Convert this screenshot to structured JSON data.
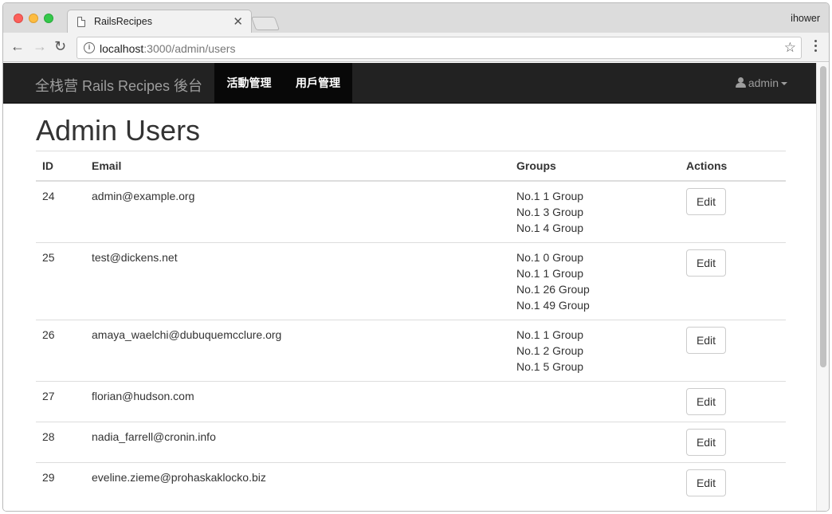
{
  "browser": {
    "tab_title": "RailsRecipes",
    "profile_user": "ihower",
    "url_host": "localhost",
    "url_path": ":3000/admin/users"
  },
  "navbar": {
    "brand": "全栈营 Rails Recipes 後台",
    "links": [
      {
        "label": "活動管理"
      },
      {
        "label": "用戶管理"
      }
    ],
    "user_menu": "admin"
  },
  "page": {
    "title": "Admin Users"
  },
  "table": {
    "headers": [
      "ID",
      "Email",
      "Groups",
      "Actions"
    ],
    "rows": [
      {
        "id": "24",
        "email": "admin@example.org",
        "groups": [
          "No.1 1 Group",
          "No.1 3 Group",
          "No.1 4 Group"
        ],
        "action": "Edit"
      },
      {
        "id": "25",
        "email": "test@dickens.net",
        "groups": [
          "No.1 0 Group",
          "No.1 1 Group",
          "No.1 26 Group",
          "No.1 49 Group"
        ],
        "action": "Edit"
      },
      {
        "id": "26",
        "email": "amaya_waelchi@dubuquemcclure.org",
        "groups": [
          "No.1 1 Group",
          "No.1 2 Group",
          "No.1 5 Group"
        ],
        "action": "Edit"
      },
      {
        "id": "27",
        "email": "florian@hudson.com",
        "groups": [],
        "action": "Edit"
      },
      {
        "id": "28",
        "email": "nadia_farrell@cronin.info",
        "groups": [],
        "action": "Edit"
      },
      {
        "id": "29",
        "email": "eveline.zieme@prohaskaklocko.biz",
        "groups": [],
        "action": "Edit"
      }
    ]
  }
}
